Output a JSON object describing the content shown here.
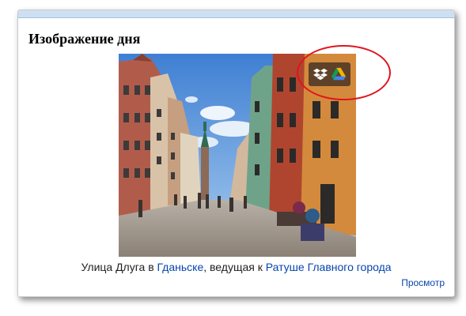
{
  "widget": {
    "title": "Изображение дня",
    "caption": {
      "prefix": "Улица Длуга в ",
      "link1": "Гданьске",
      "middle": ", ведущая к ",
      "link2": "Ратуше Главного города"
    },
    "more_link": "Просмотр"
  },
  "share_icons": [
    "dropbox-icon",
    "google-drive-icon"
  ],
  "colors": {
    "header_band": "#cedff2",
    "link": "#0645ad",
    "highlight_ring": "#e0141e"
  }
}
